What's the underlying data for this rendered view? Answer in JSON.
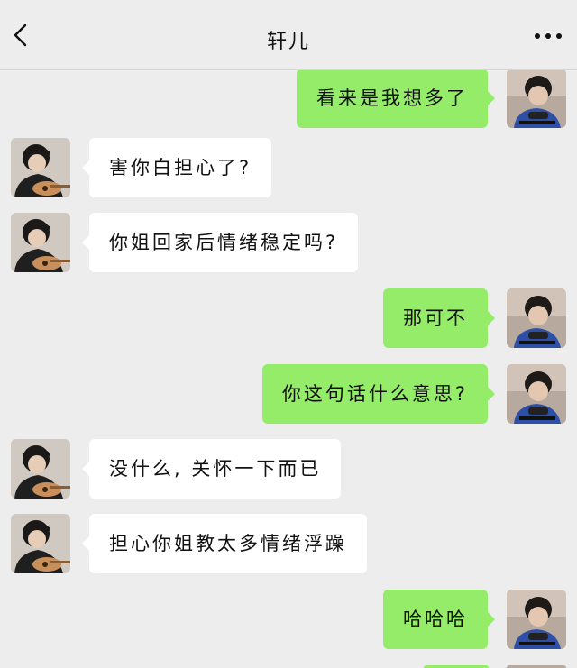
{
  "header": {
    "title": "轩儿",
    "back_icon": "chevron-left-icon",
    "more_icon": "more-dots-icon"
  },
  "colors": {
    "background": "#ededed",
    "sent_bubble": "#95ec69",
    "received_bubble": "#ffffff"
  },
  "messages": [
    {
      "side": "right",
      "text": "看来是我想多了"
    },
    {
      "side": "left",
      "text": "害你白担心了?"
    },
    {
      "side": "left",
      "text": "你姐回家后情绪稳定吗?"
    },
    {
      "side": "right",
      "text": "那可不"
    },
    {
      "side": "right",
      "text": "你这句话什么意思?"
    },
    {
      "side": "left",
      "text": "没什么, 关怀一下而已"
    },
    {
      "side": "left",
      "text": "担心你姐教太多情绪浮躁"
    },
    {
      "side": "right",
      "text": "哈哈哈"
    }
  ]
}
